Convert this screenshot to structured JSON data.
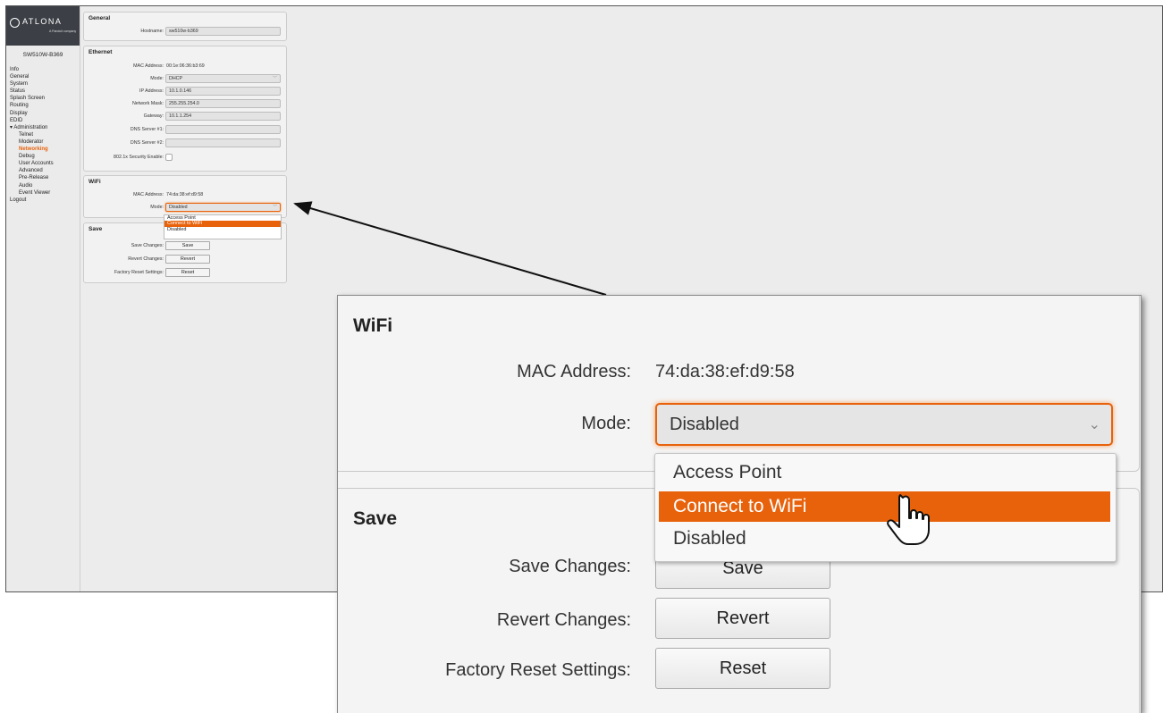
{
  "brand": {
    "name": "ATLONA",
    "tagline": "A Panduit company"
  },
  "device_name": "SW510W-B369",
  "sidebar": {
    "items": [
      {
        "label": "Info",
        "level": 0
      },
      {
        "label": "General",
        "level": 0
      },
      {
        "label": "System",
        "level": 0
      },
      {
        "label": "Status",
        "level": 0
      },
      {
        "label": "Splash Screen",
        "level": 0
      },
      {
        "label": "Routing",
        "level": 0
      },
      {
        "label": "Display",
        "level": 0
      },
      {
        "label": "EDID",
        "level": 0
      },
      {
        "label": "▾ Administration",
        "level": 0
      },
      {
        "label": "Telnet",
        "level": 1
      },
      {
        "label": "Moderator",
        "level": 1
      },
      {
        "label": "Networking",
        "level": 1,
        "active": true
      },
      {
        "label": "Debug",
        "level": 1
      },
      {
        "label": "User Accounts",
        "level": 1
      },
      {
        "label": "Advanced",
        "level": 1
      },
      {
        "label": "Pre-Release",
        "level": 1
      },
      {
        "label": "Audio",
        "level": 1
      },
      {
        "label": "Event Viewer",
        "level": 1
      },
      {
        "label": "Logout",
        "level": 0
      }
    ]
  },
  "general": {
    "title": "General",
    "hostname_label": "Hostname:",
    "hostname_value": "sw510w-b369"
  },
  "ethernet": {
    "title": "Ethernet",
    "mac_label": "MAC Address:",
    "mac_value": "00:1e:06:36:b3:69",
    "mode_label": "Mode:",
    "mode_value": "DHCP",
    "ip_label": "IP Address:",
    "ip_value": "10.1.0.146",
    "mask_label": "Network Mask:",
    "mask_value": "255.255.254.0",
    "gateway_label": "Gateway:",
    "gateway_value": "10.1.1.254",
    "dns1_label": "DNS Server #1:",
    "dns1_value": "",
    "dns2_label": "DNS Server #2:",
    "dns2_value": "",
    "security_label": "802.1x Security Enable:"
  },
  "wifi": {
    "title": "WiFi",
    "mac_label": "MAC Address:",
    "mac_value": "74:da:38:ef:d9:58",
    "mode_label": "Mode:",
    "mode_value": "Disabled",
    "options": [
      "Access Point",
      "Connect to WiFi",
      "Disabled"
    ],
    "highlighted_option": "Connect to WiFi"
  },
  "save": {
    "title": "Save",
    "save_label": "Save Changes:",
    "save_button": "Save",
    "revert_label": "Revert Changes:",
    "revert_button": "Revert",
    "reset_label": "Factory Reset Settings:",
    "reset_button": "Reset"
  },
  "colors": {
    "accent": "#e8620c",
    "sidebar_bg": "#ebebeb",
    "logo_bg": "#3c4046"
  },
  "icons": {
    "dropdown": "chevron-down-icon",
    "pointer": "hand-pointer-icon",
    "callout": "arrow-icon"
  }
}
